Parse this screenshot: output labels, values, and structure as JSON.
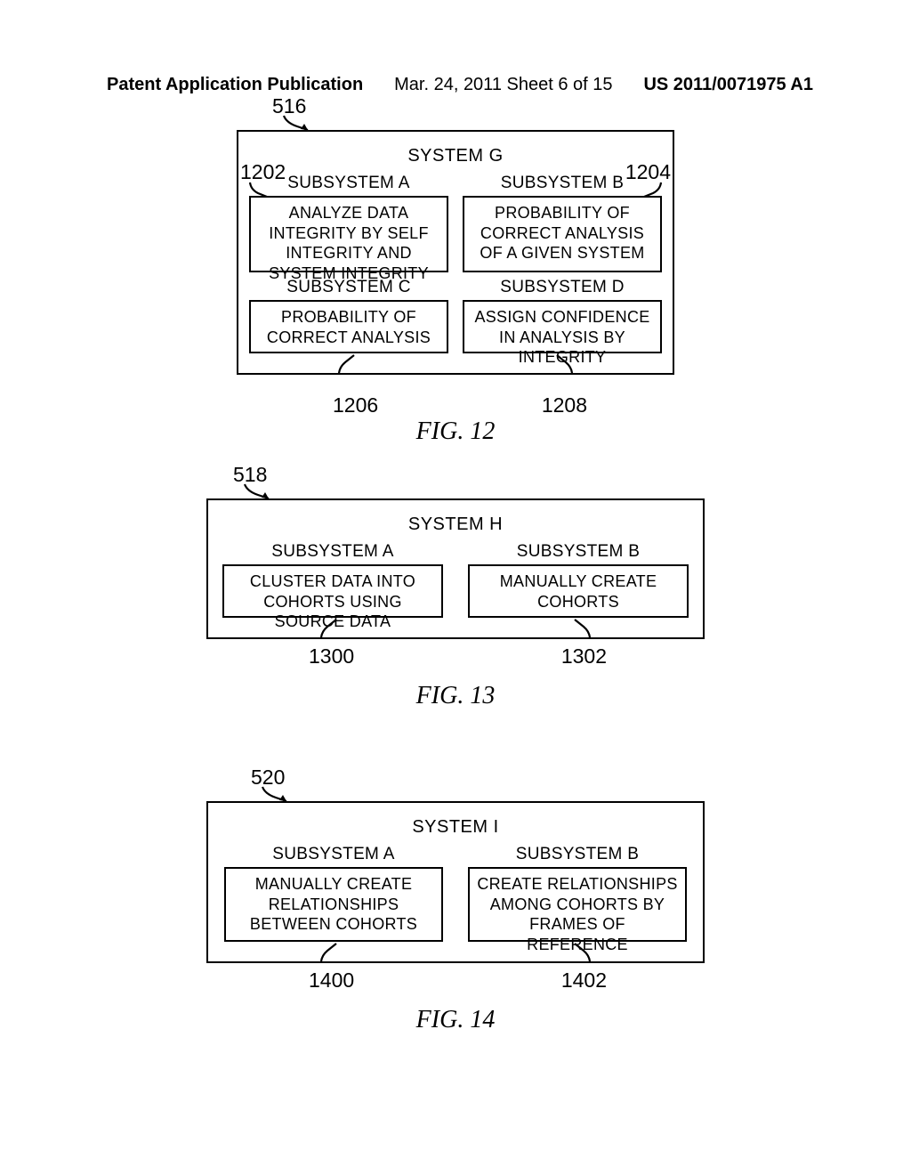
{
  "header": {
    "left": "Patent Application Publication",
    "center": "Mar. 24, 2011  Sheet 6 of 15",
    "right": "US 2011/0071975 A1"
  },
  "fig12": {
    "ref_top": "516",
    "title": "SYSTEM G",
    "label_left_top": "1202",
    "label_right_top": "1204",
    "label_left_bot": "1206",
    "label_right_bot": "1208",
    "subA": {
      "header": "SUBSYSTEM A",
      "body": "ANALYZE DATA INTEGRITY BY SELF INTEGRITY AND SYSTEM INTEGRITY"
    },
    "subB": {
      "header": "SUBSYSTEM B",
      "body": "PROBABILITY OF CORRECT ANALYSIS OF A GIVEN SYSTEM"
    },
    "subC": {
      "header": "SUBSYSTEM C",
      "body": "PROBABILITY OF CORRECT ANALYSIS"
    },
    "subD": {
      "header": "SUBSYSTEM D",
      "body": "ASSIGN CONFIDENCE IN ANALYSIS BY INTEGRITY"
    },
    "caption": "FIG. 12"
  },
  "fig13": {
    "ref_top": "518",
    "title": "SYSTEM H",
    "label_left": "1300",
    "label_right": "1302",
    "subA": {
      "header": "SUBSYSTEM A",
      "body": "CLUSTER DATA INTO COHORTS USING SOURCE DATA"
    },
    "subB": {
      "header": "SUBSYSTEM B",
      "body": "MANUALLY CREATE COHORTS"
    },
    "caption": "FIG. 13"
  },
  "fig14": {
    "ref_top": "520",
    "title": "SYSTEM I",
    "label_left": "1400",
    "label_right": "1402",
    "subA": {
      "header": "SUBSYSTEM A",
      "body": "MANUALLY CREATE RELATIONSHIPS BETWEEN COHORTS"
    },
    "subB": {
      "header": "SUBSYSTEM B",
      "body": "CREATE RELATIONSHIPS AMONG COHORTS BY FRAMES OF REFERENCE"
    },
    "caption": "FIG. 14"
  }
}
